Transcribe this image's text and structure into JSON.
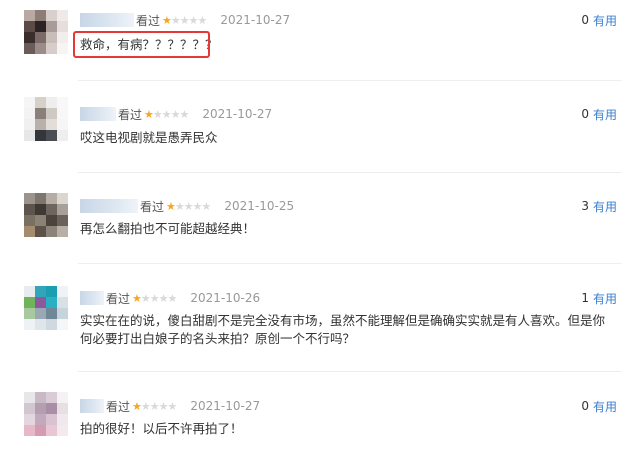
{
  "reviews": [
    {
      "watched": "看过",
      "stars": 1,
      "date": "2021-10-27",
      "useful_count": "0",
      "useful_label": "有用",
      "text": "救命，有病？？？？？？"
    },
    {
      "watched": "看过",
      "stars": 1,
      "date": "2021-10-27",
      "useful_count": "0",
      "useful_label": "有用",
      "text": "哎这电视剧就是愚弄民众"
    },
    {
      "watched": "看过",
      "stars": 1,
      "date": "2021-10-25",
      "useful_count": "3",
      "useful_label": "有用",
      "text": "再怎么翻拍也不可能超越经典！"
    },
    {
      "watched": "看过",
      "stars": 1,
      "date": "2021-10-26",
      "useful_count": "1",
      "useful_label": "有用",
      "text": "实实在在的说，傻白甜剧不是完全没有市场，虽然不能理解但是确确实实就是有人喜欢。但是你何必要打出白娘子的名头来拍？原创一个不行吗？"
    },
    {
      "watched": "看过",
      "stars": 1,
      "date": "2021-10-27",
      "useful_count": "0",
      "useful_label": "有用",
      "text": "拍的很好！以后不许再拍了！"
    }
  ],
  "colors": {
    "star": "#f5a623",
    "link": "#3b7fd0",
    "highlight": "#e53935"
  }
}
